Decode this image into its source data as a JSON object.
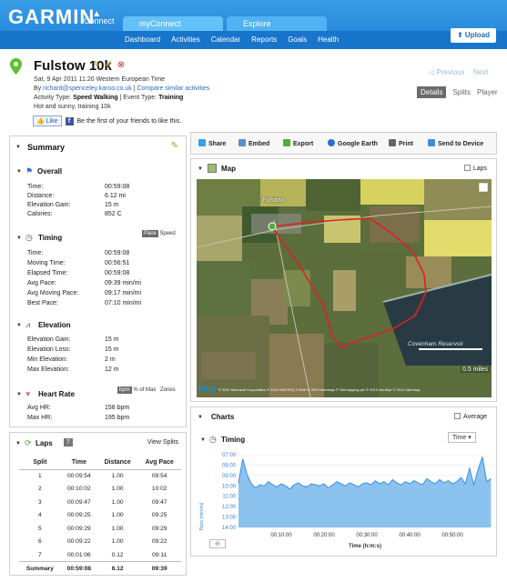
{
  "header": {
    "logo": "GARMIN",
    "logo_sub": "Connect",
    "tabs": [
      "myConnect",
      "Explore"
    ],
    "nav": [
      "Dashboard",
      "Activities",
      "Calendar",
      "Reports",
      "Goals",
      "Health"
    ],
    "upload": "Upload"
  },
  "activity": {
    "title": "Fulstow 10k",
    "date": "Sat, 9 Apr 2011 11:20 Western European Time",
    "by_prefix": "By",
    "by_user": "richard@spenceley.karoo.co.uk",
    "compare_link": "Compare similar activities",
    "type_label": "Activity Type:",
    "type_value": "Speed Walking",
    "event_label": "| Event Type:",
    "event_value": "Training",
    "notes": "Hot and sunny, training 10k",
    "like_button": "Like",
    "like_text": "Be the first of your friends to like this.",
    "previous": "Previous",
    "next": "Next",
    "view_tabs": [
      "Details",
      "Splits",
      "Player"
    ]
  },
  "summary": {
    "title": "Summary",
    "overall": {
      "title": "Overall",
      "rows": [
        {
          "label": "Time:",
          "value": "00:59:08"
        },
        {
          "label": "Distance:",
          "value": "6.12 mi"
        },
        {
          "label": "Elevation Gain:",
          "value": "15 m"
        },
        {
          "label": "Calories:",
          "value": "852 C"
        }
      ]
    },
    "timing": {
      "title": "Timing",
      "toggle": [
        "Pace",
        "Speed"
      ],
      "rows": [
        {
          "label": "Time:",
          "value": "00:59:08"
        },
        {
          "label": "Moving Time:",
          "value": "00:56:51"
        },
        {
          "label": "Elapsed Time:",
          "value": "00:59:08"
        },
        {
          "label": "Avg Pace:",
          "value": "09:39 min/mi"
        },
        {
          "label": "Avg Moving Pace:",
          "value": "09:17 min/mi"
        },
        {
          "label": "Best Pace:",
          "value": "07:10 min/mi"
        }
      ]
    },
    "elevation": {
      "title": "Elevation",
      "rows": [
        {
          "label": "Elevation Gain:",
          "value": "15 m"
        },
        {
          "label": "Elevation Loss:",
          "value": "15 m"
        },
        {
          "label": "Min Elevation:",
          "value": "2 m"
        },
        {
          "label": "Max Elevation:",
          "value": "12 m"
        }
      ]
    },
    "heart_rate": {
      "title": "Heart Rate",
      "toggle": [
        "bpm",
        "% of Max",
        "Zones"
      ],
      "rows": [
        {
          "label": "Avg HR:",
          "value": "158 bpm"
        },
        {
          "label": "Max HR:",
          "value": "195 bpm"
        }
      ]
    }
  },
  "laps": {
    "title": "Laps",
    "count": "7",
    "view_splits": "View Splits",
    "columns": [
      "Split",
      "Time",
      "Distance",
      "Avg Pace"
    ],
    "rows": [
      [
        "1",
        "00:09:54",
        "1.00",
        "09:54"
      ],
      [
        "2",
        "00:10:02",
        "1.00",
        "10:02"
      ],
      [
        "3",
        "00:09:47",
        "1.00",
        "09:47"
      ],
      [
        "4",
        "00:09:25",
        "1.00",
        "09:25"
      ],
      [
        "5",
        "00:09:29",
        "1.00",
        "09:29"
      ],
      [
        "6",
        "00:09:22",
        "1.00",
        "09:22"
      ],
      [
        "7",
        "00:01:06",
        "0.12",
        "09:11"
      ]
    ],
    "total": [
      "Summary",
      "00:59:08",
      "6.12",
      "09:39"
    ]
  },
  "toolbar": {
    "items": [
      "Share",
      "Embed",
      "Export",
      "Google Earth",
      "Print",
      "Send to Device"
    ]
  },
  "map": {
    "title": "Map",
    "laps_toggle": "Laps",
    "labels": {
      "town": "Fulstow",
      "reservoir": "Covenham Reservoir",
      "scale": "0.5 miles",
      "attribution": "© 2011 Microsoft Corporation  © 2010 NAVTEQ  © AND  © 2010 Intermap  © Getmapping plc  © 2010 GeoEye  © 2010 Intermap",
      "bing": "bing"
    }
  },
  "charts": {
    "title": "Charts",
    "average_toggle": "Average",
    "timing_title": "Timing",
    "dropdown": "Time"
  },
  "chart_data": {
    "type": "area",
    "title": "",
    "xlabel": "Time (h:m:s)",
    "ylabel": "Pace (min/mi)",
    "y_reversed": true,
    "ylim": [
      7.0,
      14.0
    ],
    "y_ticks": [
      "07:00",
      "08:00",
      "09:00",
      "10:00",
      "11:00",
      "12:00",
      "13:00",
      "14:00"
    ],
    "x_ticks": [
      "00:10:00",
      "00:20:00",
      "00:30:00",
      "00:40:00",
      "00:50:00"
    ],
    "xlim_minutes": [
      0,
      59.13
    ],
    "series": [
      {
        "color": "#3a8fe0",
        "x_minutes": [
          0,
          1,
          2,
          3,
          4,
          5,
          6,
          7,
          8,
          9,
          10,
          11,
          12,
          13,
          14,
          15,
          16,
          17,
          18,
          19,
          20,
          21,
          22,
          23,
          24,
          25,
          26,
          27,
          28,
          29,
          30,
          31,
          32,
          33,
          34,
          35,
          36,
          37,
          38,
          39,
          40,
          41,
          42,
          43,
          44,
          45,
          46,
          47,
          48,
          49,
          50,
          51,
          52,
          53,
          54,
          55,
          56,
          57,
          58,
          59
        ],
        "pace_minutes": [
          9.7,
          7.4,
          8.9,
          9.8,
          10.2,
          9.9,
          10.0,
          9.6,
          9.9,
          10.1,
          9.8,
          10.0,
          10.3,
          9.9,
          9.7,
          10.0,
          10.1,
          9.8,
          9.9,
          10.0,
          9.8,
          10.2,
          9.9,
          9.6,
          9.8,
          10.0,
          9.7,
          9.9,
          10.1,
          9.8,
          9.7,
          9.9,
          9.5,
          9.8,
          9.6,
          9.9,
          9.4,
          9.7,
          9.9,
          9.6,
          9.8,
          9.5,
          9.7,
          9.9,
          9.3,
          9.6,
          9.8,
          9.4,
          9.7,
          9.5,
          9.8,
          9.6,
          9.2,
          9.8,
          8.3,
          9.9,
          8.4,
          7.2,
          9.6,
          9.3
        ]
      }
    ]
  },
  "colors": {
    "brand_blue": "#1f7fd6",
    "route_red": "#e02020",
    "chart_blue": "#3a8fe0",
    "link": "#2b6bbf"
  }
}
